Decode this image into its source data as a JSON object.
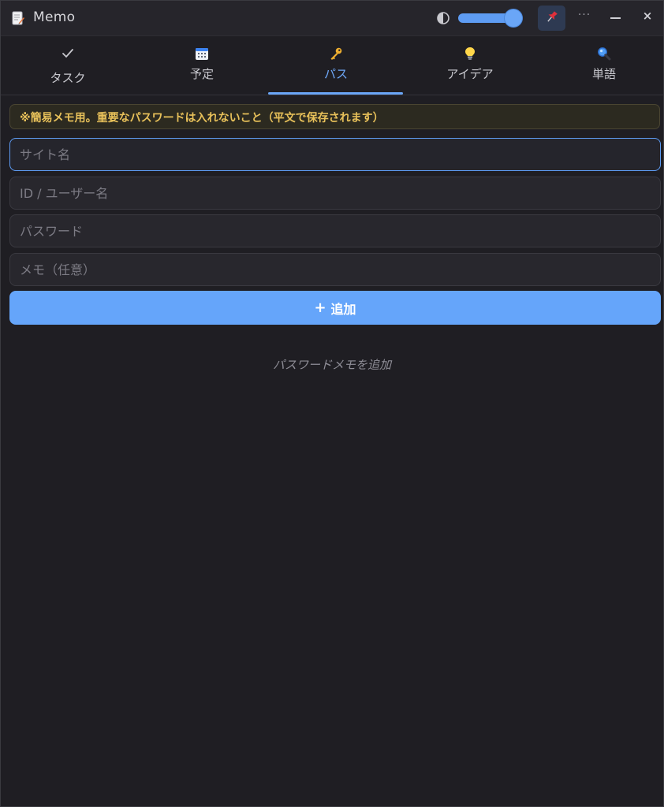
{
  "app": {
    "title": "Memo",
    "icon": "memo-pencil-icon"
  },
  "titlebar": {
    "contrast_icon": "contrast-icon",
    "opacity_level_percent": 92,
    "pin_icon": "pushpin-icon",
    "more_label": "···",
    "minimize_icon": "minimize-icon",
    "close_label": "×"
  },
  "tabs": [
    {
      "label": "タスク",
      "icon": "check-icon"
    },
    {
      "label": "予定",
      "icon": "calendar-icon"
    },
    {
      "label": "パス",
      "icon": "key-icon",
      "active": true
    },
    {
      "label": "アイデア",
      "icon": "lightbulb-icon"
    },
    {
      "label": "単語",
      "icon": "magnifier-icon"
    }
  ],
  "warning": {
    "text": "※簡易メモ用。重要なパスワードは入れないこと（平文で保存されます）"
  },
  "form": {
    "site_placeholder": "サイト名",
    "id_placeholder": "ID / ユーザー名",
    "password_placeholder": "パスワード",
    "memo_placeholder": "メモ（任意）",
    "add_label": "追加",
    "add_icon": "+"
  },
  "empty_state": {
    "text": "パスワードメモを追加"
  },
  "colors": {
    "accent": "#65a5fa",
    "background": "#1f1e23",
    "warning_text": "#e8c15a"
  }
}
